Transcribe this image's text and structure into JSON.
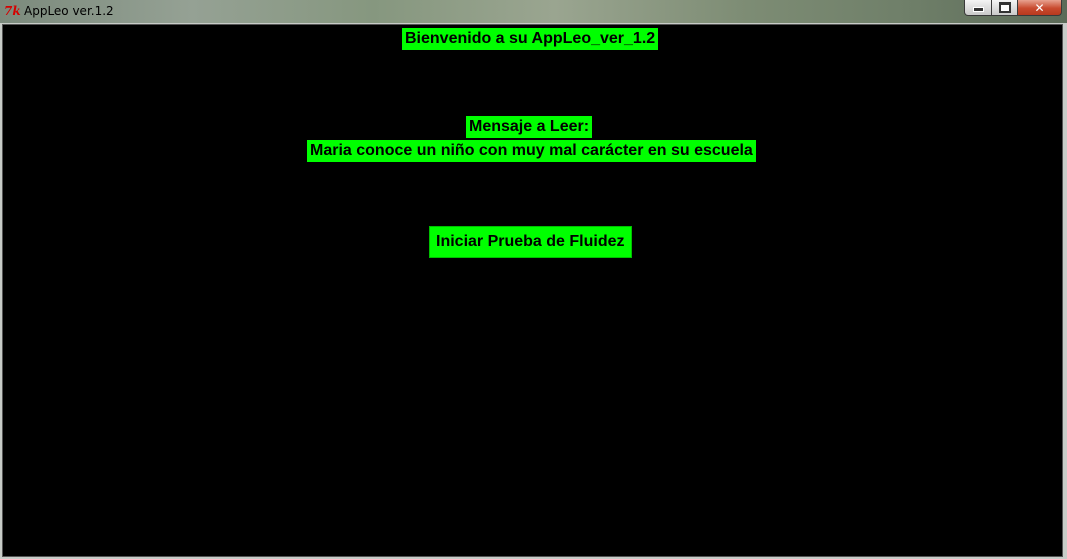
{
  "window": {
    "icon": "tk-feather-icon",
    "icon_glyph": "7k",
    "title": "AppLeo ver.1.2",
    "close_glyph": "✕"
  },
  "content": {
    "welcome": "Bienvenido a su AppLeo_ver_1.2",
    "message_label": "Mensaje a Leer:",
    "message_text": "Maria conoce un niño con muy mal carácter en su escuela",
    "start_button": "Iniciar Prueba de Fluidez"
  },
  "colors": {
    "background": "#000000",
    "label_bg": "#00ff00"
  }
}
